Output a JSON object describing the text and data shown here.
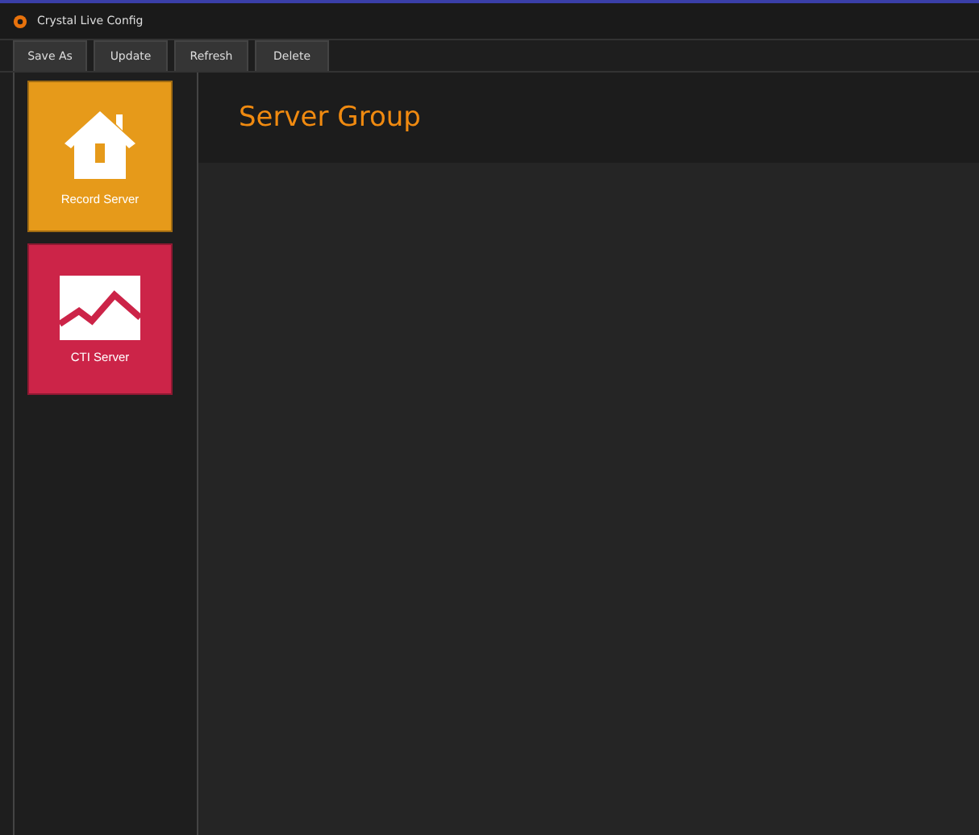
{
  "window": {
    "title": "Crystal Live Config"
  },
  "toolbar": [
    "Save As",
    "Update",
    "Refresh",
    "Delete"
  ],
  "tiles": [
    {
      "label": "Record Server",
      "kind": "house",
      "color": "#e69a1a"
    },
    {
      "label": "CTI Server",
      "kind": "chart",
      "color": "#cc2448"
    }
  ],
  "content": {
    "title": "Server Group"
  }
}
